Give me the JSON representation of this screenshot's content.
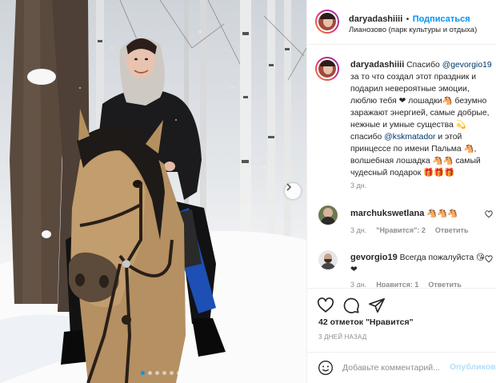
{
  "post": {
    "username": "daryadashiiii",
    "follow_separator": "•",
    "follow_label": "Подписаться",
    "location": "Лианозово (парк культуры и отдыха)",
    "caption": {
      "username": "daryadashiiii",
      "text_1": "Спасибо ",
      "mention_1": "@gevorgio19",
      "text_2": " за то что создал этот праздник и подарил невероятные эмоции, люблю тебя ❤ лошадки🐴 безумно заражают энергией, самые добрые, нежные и умные существа 💫 спасибо ",
      "mention_2": "@kskmatador",
      "text_3": " и этой принцессе по имени Пальма 🐴, волшебная лошадка 🐴🐴 самый чудесный подарок 🎁🎁🎁",
      "time": "3 дн."
    },
    "comments": [
      {
        "username": "marchukswetlana",
        "text": "🐴🐴🐴",
        "time": "3 дн.",
        "likes_label": "\"Нравится\": 2",
        "reply_label": "Ответить"
      },
      {
        "username": "gevorgio19",
        "text": "Всегда пожалуйста 😘 ❤",
        "time": "3 дн.",
        "likes_label": "Нравится: 1",
        "reply_label": "Ответить"
      }
    ],
    "likes_text": "42 отметок \"Нравится\"",
    "date_text": "3 ДНЕЙ НАЗАД",
    "comment_placeholder": "Добавьте комментарий...",
    "publish_label": "Опубликовать",
    "carousel": {
      "slides": 6,
      "active_index": 0
    },
    "colors": {
      "accent": "#0095f6",
      "publish_disabled": "#b2dffc",
      "muted": "#8e8e8e"
    }
  }
}
